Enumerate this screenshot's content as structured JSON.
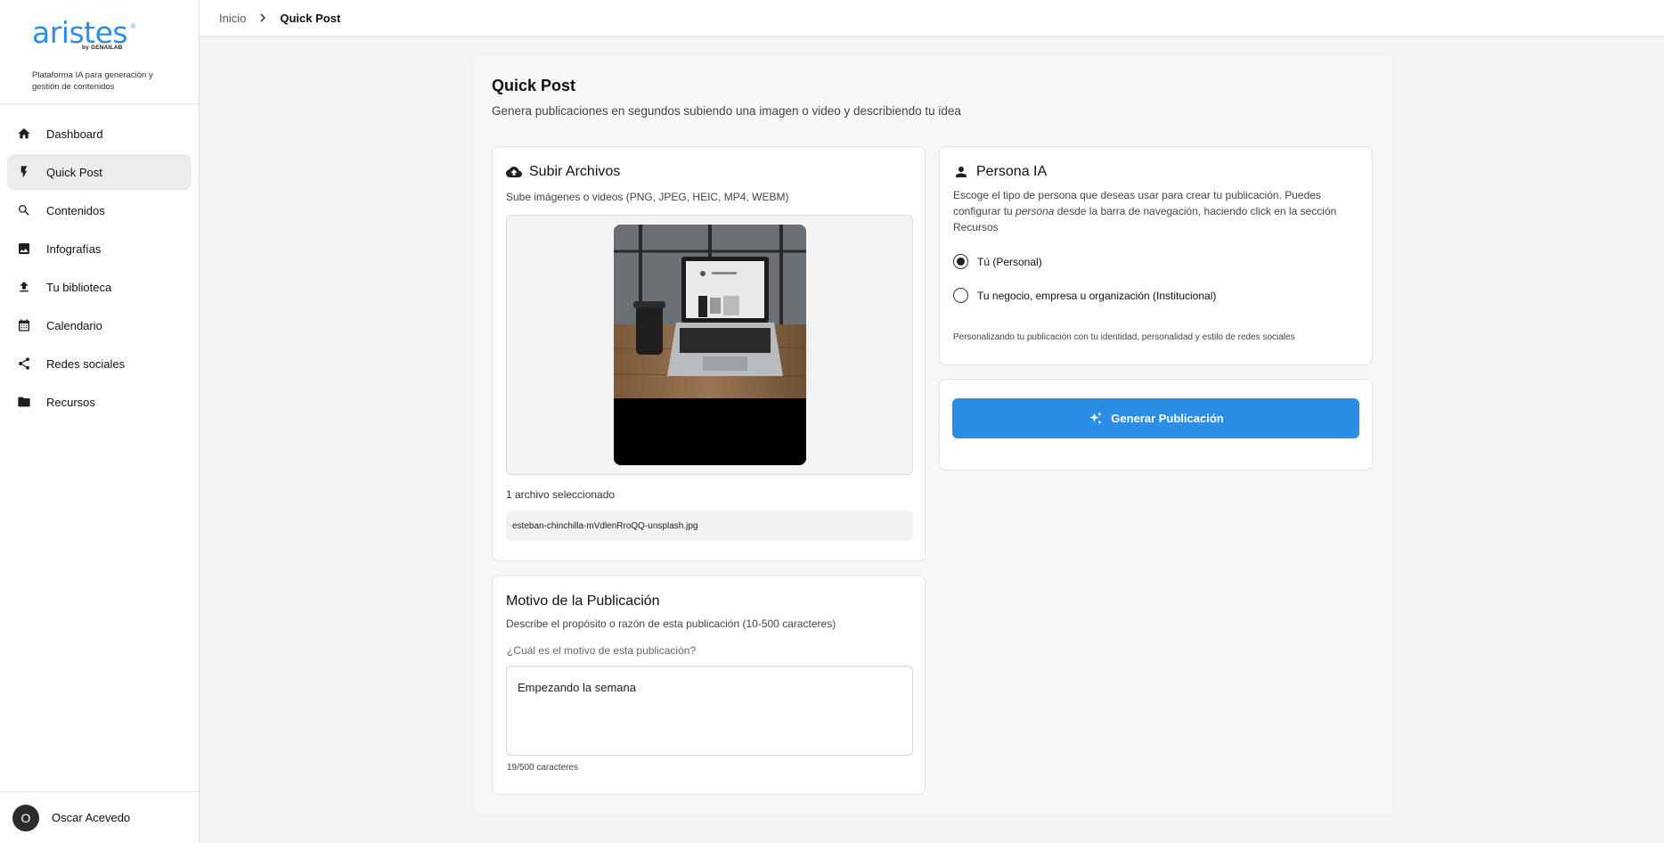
{
  "brand": {
    "name": "aristes",
    "by": "by GENAILAB",
    "tagline": "Plataforma IA para generación y gestión de contenidos",
    "color": "#2b8ee6"
  },
  "sidebar": {
    "items": [
      {
        "label": "Dashboard",
        "icon": "home-icon"
      },
      {
        "label": "Quick Post",
        "icon": "bolt-icon",
        "active": true
      },
      {
        "label": "Contenidos",
        "icon": "search-icon"
      },
      {
        "label": "Infografías",
        "icon": "image-icon"
      },
      {
        "label": "Tu biblioteca",
        "icon": "upload-icon"
      },
      {
        "label": "Calendario",
        "icon": "calendar-icon"
      },
      {
        "label": "Redes sociales",
        "icon": "share-icon"
      },
      {
        "label": "Recursos",
        "icon": "folder-icon"
      }
    ]
  },
  "user": {
    "initial": "O",
    "name": "Oscar Acevedo"
  },
  "breadcrumb": {
    "home": "Inicio",
    "current": "Quick Post"
  },
  "page": {
    "title": "Quick Post",
    "subtitle": "Genera publicaciones en segundos subiendo una imagen o video y describiendo tu idea"
  },
  "upload": {
    "title": "Subir Archivos",
    "description": "Sube imágenes o videos (PNG, JPEG, HEIC, MP4, WEBM)",
    "count_text": "1 archivo seleccionado",
    "file_name": "esteban-chinchilla-mVdlenRroQQ-unsplash.jpg"
  },
  "motivo": {
    "title": "Motivo de la Publicación",
    "description": "Describe el propósito o razón de esta publicación (10-500 caracteres)",
    "label": "¿Cuál es el motivo de esta publicación?",
    "value": "Empezando la semana",
    "char_count": "19/500 caracteres"
  },
  "persona": {
    "title": "Persona IA",
    "desc_part1": "Escoge el tipo de persona que deseas usar para crear tu publicación. Puedes configurar tu ",
    "desc_em": "persona",
    "desc_part2": " desde la barra de navegación, haciendo click en la sección Recursos",
    "options": [
      {
        "label": "Tú (Personal)",
        "selected": true
      },
      {
        "label": "Tu negocio, empresa u organización (Institucional)",
        "selected": false
      }
    ],
    "note": "Personalizando tu publicación con tu identidad, personalidad y estilo de redes sociales"
  },
  "generate": {
    "label": "Generar Publicación",
    "icon": "sparkles-icon"
  }
}
